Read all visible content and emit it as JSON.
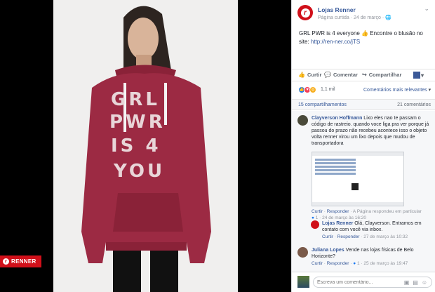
{
  "brand_badge": {
    "label": "RENNER"
  },
  "photo": {
    "shirt_text": [
      "GRL",
      "PWR",
      "IS 4",
      "YOU"
    ]
  },
  "post": {
    "page_name": "Lojas Renner",
    "meta": "Página curtida · 24 de março · 🌐",
    "text": "GRL PWR is 4 everyone 👍 Encontre o blusão no site: ",
    "link": "http://ren-ner.co/jTS"
  },
  "actions": {
    "like": "Curtir",
    "comment": "Comentar",
    "share": "Compartilhar"
  },
  "reactions": {
    "count": "1,1 mil",
    "relevance": "Comentários mais relevantes",
    "relevance_caret": "▾"
  },
  "counts": {
    "shares": "15 compartilhamentos",
    "comments": "21 comentários"
  },
  "comments": [
    {
      "author": "Clayverson Hoffmann",
      "text": " Lixo eles nao te passam o código de rastreio. quando voce liga pra ver porque já passou do prazo não recebeu acontece isso o objeto volta renner virou um lixo depois que mudou de transportadora",
      "actions": {
        "like": "Curtir",
        "reply": "Responder",
        "likes": "1",
        "reply_note": "A Página respondeu em particular",
        "time": "24 de março às 16:20"
      }
    },
    {
      "author": "Lojas Renner",
      "text": " Olá, Clayverson. Entramos em contato com você via inbox.",
      "actions": {
        "like": "Curtir",
        "reply": "Responder",
        "time": "27 de março às 10:32"
      }
    },
    {
      "author": "Juliana Lopes",
      "text": " Vende nas lojas físicas de Belo Horizonte?",
      "actions": {
        "like": "Curtir",
        "reply": "Responder",
        "likes": "1",
        "time": "25 de março às 19:47"
      }
    }
  ],
  "composer": {
    "placeholder": "Escreva um comentário..."
  },
  "colors": {
    "brand": "#d0101a",
    "link": "#365899",
    "shirt": "#9c2a43"
  }
}
